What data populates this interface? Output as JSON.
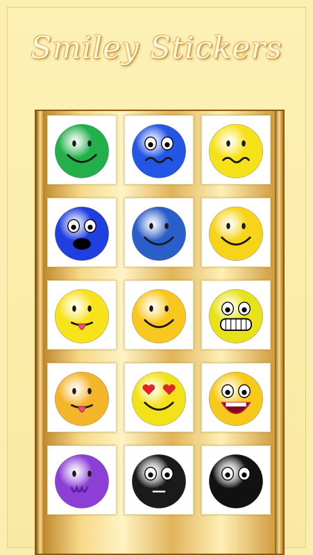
{
  "app": {
    "title": "Smiley Stickers"
  },
  "stickers": [
    {
      "icon": "green-smiley-icon",
      "color": "#22b04a",
      "mouth": "smile",
      "eyes": "dots"
    },
    {
      "icon": "blue-worried-smiley-icon",
      "color": "#2456e6",
      "mouth": "wavy",
      "eyes": "big"
    },
    {
      "icon": "yellow-nauseous-smiley-icon",
      "color": "#f6e21a",
      "mouth": "wavy",
      "eyes": "dots"
    },
    {
      "icon": "blue-shocked-smiley-icon",
      "color": "#1f3fe0",
      "mouth": "open",
      "eyes": "big"
    },
    {
      "icon": "dark-blue-smiley-icon",
      "color": "#2a5ec8",
      "mouth": "smile",
      "eyes": "dots"
    },
    {
      "icon": "watchmen-smiley-icon",
      "color": "#f7d41a",
      "mouth": "smile",
      "eyes": "dots"
    },
    {
      "icon": "tongue-out-smiley-icon",
      "color": "#f8e21c",
      "mouth": "tongue",
      "eyes": "dots"
    },
    {
      "icon": "small-yellow-smiley-icon",
      "color": "#f9c81e",
      "mouth": "smile",
      "eyes": "dots"
    },
    {
      "icon": "big-grin-smiley-icon",
      "color": "#e8e21a",
      "mouth": "grin",
      "eyes": "big"
    },
    {
      "icon": "winking-tongue-smiley-icon",
      "color": "#f5b52a",
      "mouth": "tongue",
      "eyes": "dots"
    },
    {
      "icon": "heart-eyes-smiley-icon",
      "color": "#f3e21a",
      "mouth": "smile",
      "eyes": "hearts"
    },
    {
      "icon": "laughing-lady-smiley-icon",
      "color": "#f7c91a",
      "mouth": "laugh",
      "eyes": "big"
    },
    {
      "icon": "purple-smiley-icon",
      "color": "#8c3fd6",
      "mouth": "w",
      "eyes": "dots"
    },
    {
      "icon": "black-scared-smiley-icon",
      "color": "#1a1a1a",
      "mouth": "flat",
      "eyes": "big"
    },
    {
      "icon": "black-bomb-smiley-icon",
      "color": "#111111",
      "mouth": "none",
      "eyes": "big"
    }
  ]
}
